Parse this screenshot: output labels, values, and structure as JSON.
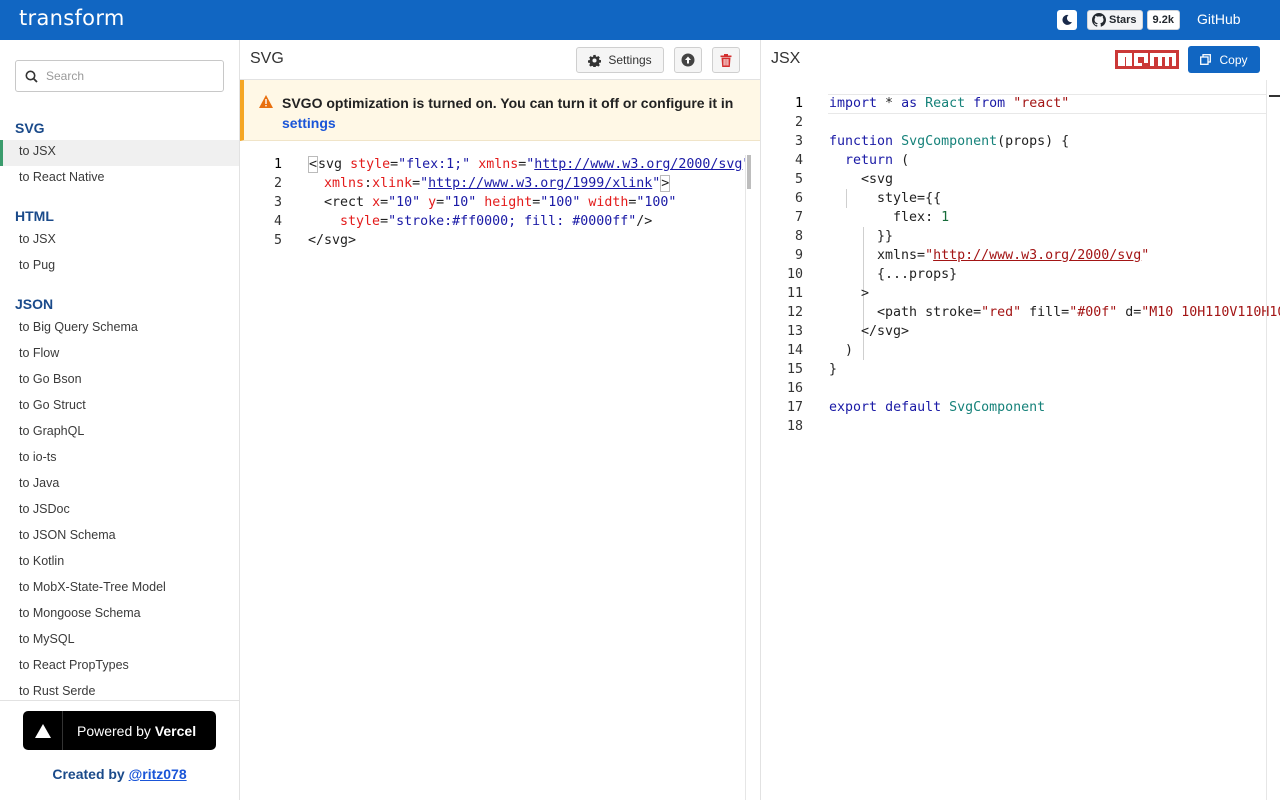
{
  "app": {
    "brand": "transform",
    "stars_label": "Stars",
    "stars_count": "9.2k",
    "github_label": "GitHub"
  },
  "sidebar": {
    "search_placeholder": "Search",
    "sections": [
      {
        "title": "SVG",
        "items": [
          "to JSX",
          "to React Native"
        ]
      },
      {
        "title": "HTML",
        "items": [
          "to JSX",
          "to Pug"
        ]
      },
      {
        "title": "JSON",
        "items": [
          "to Big Query Schema",
          "to Flow",
          "to Go Bson",
          "to Go Struct",
          "to GraphQL",
          "to io-ts",
          "to Java",
          "to JSDoc",
          "to JSON Schema",
          "to Kotlin",
          "to MobX-State-Tree Model",
          "to Mongoose Schema",
          "to MySQL",
          "to React PropTypes",
          "to Rust Serde"
        ]
      }
    ],
    "active_item": "SVG / to JSX",
    "footer": {
      "powered_prefix": "Powered by",
      "powered_brand": "Vercel",
      "created_prefix": "Created by",
      "created_handle": "@ritz078"
    }
  },
  "input_pane": {
    "title": "SVG",
    "settings_label": "Settings",
    "warning_text": "SVGO optimization is turned on. You can turn it off or configure it in",
    "warning_link": "settings",
    "line_numbers": [
      "1",
      "2",
      "3",
      "4",
      "5"
    ]
  },
  "output_pane": {
    "title": "JSX",
    "copy_label": "Copy",
    "line_numbers": [
      "1",
      "2",
      "3",
      "4",
      "5",
      "6",
      "7",
      "8",
      "9",
      "10",
      "11",
      "12",
      "13",
      "14",
      "15",
      "16",
      "17",
      "18"
    ]
  },
  "colors": {
    "topbar": "#1166c2",
    "accent": "#3b9c6d",
    "warning_bg": "#fff8e6",
    "warning_border": "#f5a623",
    "npm_red": "#cb3837",
    "delete_red": "#d32f2f"
  }
}
